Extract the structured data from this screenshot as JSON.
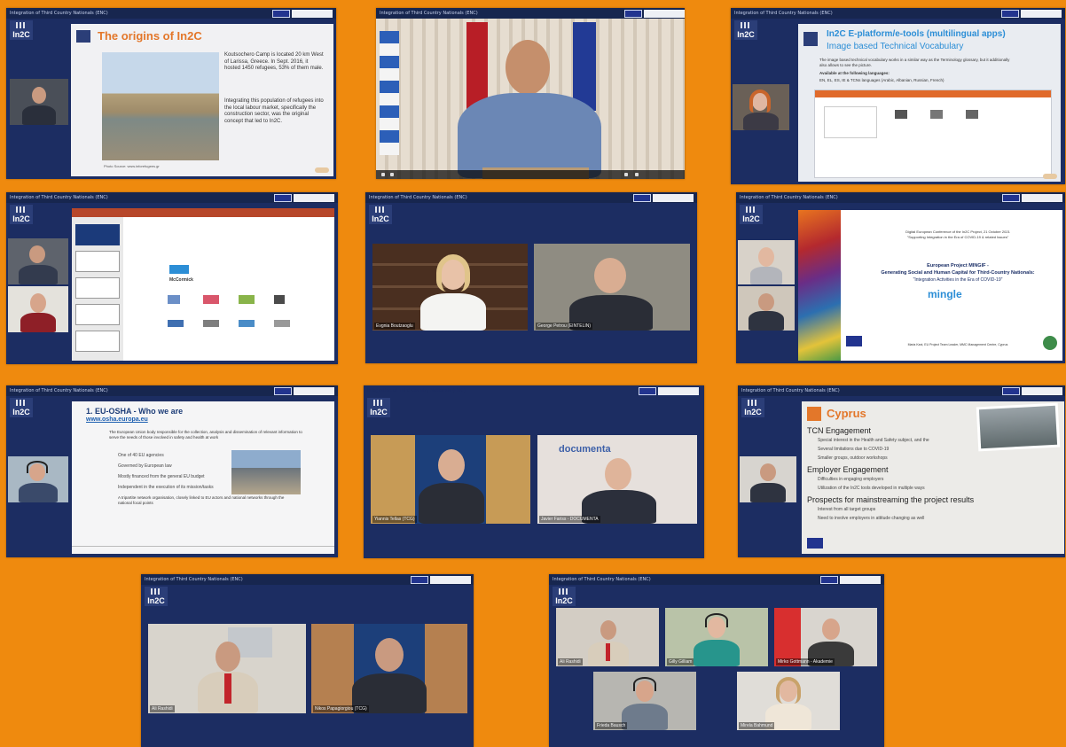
{
  "header_title": "Integration of Third Country Nationals (ENC)",
  "logo_text": "In2C",
  "panel1": {
    "slide_title": "The origins of In2C",
    "body": "Koutsochero Camp is located 20 km West of Larissa, Greece. In Sept. 2016, it hosted 1450 refugees, 53% of them male.",
    "body2": "Integrating this population of refugees into the local labour market, specifically the construction sector, was the original concept that led to In2C.",
    "caption": "Photo Source: www.inforefugees.gr"
  },
  "panel3": {
    "slide_title": "In2C E-platform/e-tools (multilingual apps)",
    "slide_subtitle": "Image based Technical Vocabulary",
    "line1": "The image based technical vocabulary works in a similar way as the Terminology glossary, but it additionally also allows to see the picture.",
    "line2": "Available at the following languages:",
    "line3": "EN, EL, ES, IE & TCNs languages (Arabic, Albanian, Russian, French)"
  },
  "panel4": {
    "slide_text": "McCormick"
  },
  "panel5": {
    "name_left": "Evgnia Boutzaoglu",
    "name_right": "George Petrou (EINTELIN)"
  },
  "panel6": {
    "conf": "Digital European Conference of the In2C Project, 21 October 2021",
    "conf2": "\"Supporting Integration in the Era of COVID-19 & related Issues\"",
    "project": "European Project MINGIF -",
    "project2": "Generating Social and Human Capital for Third-Country Nationals:",
    "project3": "\"Integration Activities in the Era of COVID-19\"",
    "brand": "mingle",
    "footer": "Maria Kani, EU Project Team Leader, MMC Management Centre, Cyprus"
  },
  "panel7": {
    "slide_title": "1. EU-OSHA - Who we are",
    "link": "www.osha.europa.eu",
    "intro": "The European Union body responsible for the collection, analysis and dissemination of relevant information to serve the needs of those involved in safety and health at work",
    "b1": "One of 40 EU agencies",
    "b2": "Governed by European law",
    "b3": "Mostly financed from the general EU budget",
    "b4": "Independent in the execution of its mission/tasks",
    "b5": "A tripartite network organisation, closely linked to EU actors and national networks through the national focal points"
  },
  "panel8": {
    "name_left": "Yiannis Tellas (TCG)",
    "name_right": "Javier Fariss - DOCUMENTA",
    "banner": "documenta"
  },
  "panel9": {
    "slide_title": "Cyprus",
    "h1": "TCN Engagement",
    "i1": "Special interest in the Health and Safety subject, and the",
    "i2": "Several limitations due to COVID-19",
    "i3": "Smaller groups, outdoor workshops",
    "h2": "Employer Engagement",
    "i4": "Difficulties in engaging employers",
    "i5": "Utilization of the In2C tools developed in multiple ways",
    "h3": "Prospects for mainstreaming the project results",
    "i6": "Interest from all target groups",
    "i7": "Need to involve employers in attitude changing as well"
  },
  "panel10": {
    "name_left": "Ali Rashidi",
    "name_right": "Nikos Papagiorgiou (TCG)"
  },
  "panel11": {
    "n1": "Ali Rashidi",
    "n2": "Gilly Gilliam",
    "n3": "Mirko Gottmann - Akademie",
    "n4": "Frieda Bausch",
    "n5": "Mirela Bahmund"
  },
  "colors": {
    "background": "#ef8a0e",
    "panel": "#1c2d62",
    "accent_orange": "#e3772a",
    "brand_blue": "#2c8ed6"
  }
}
